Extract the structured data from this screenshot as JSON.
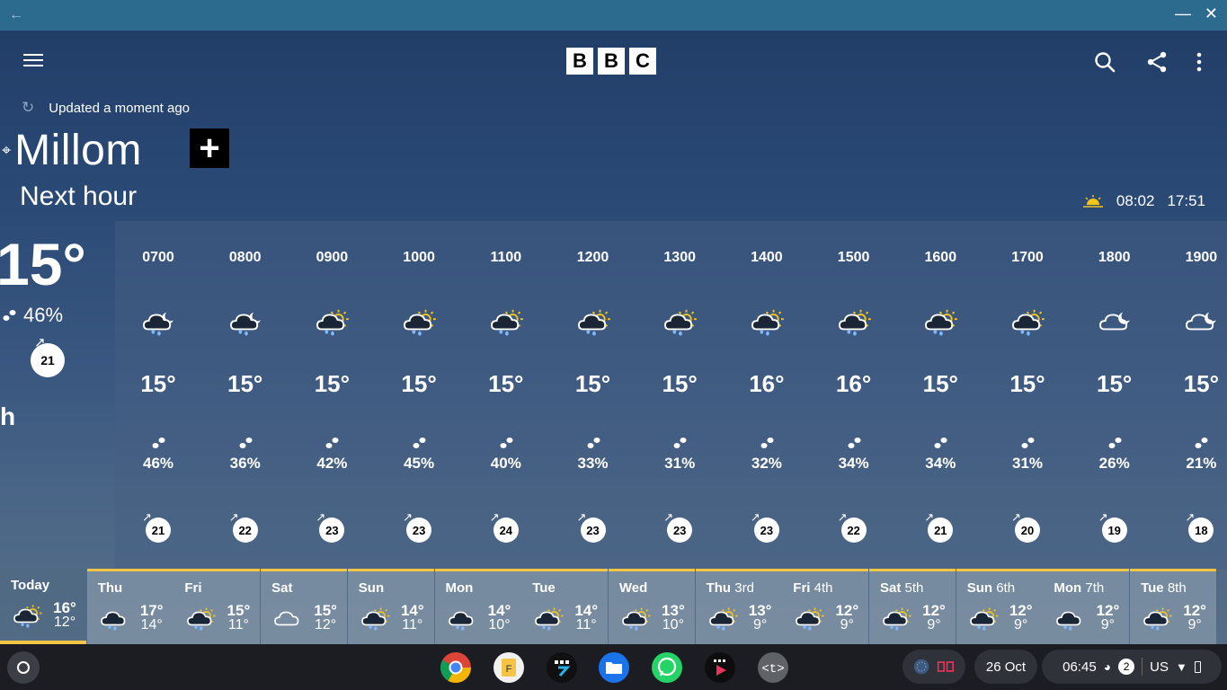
{
  "titlebar": {
    "back_icon": "arrow-left-icon",
    "minimize_icon": "minimize-icon",
    "close_icon": "close-icon"
  },
  "header": {
    "logo_letters": [
      "B",
      "B",
      "C"
    ],
    "menu_icon": "menu-icon",
    "search_icon": "search-icon",
    "share_icon": "share-icon",
    "more_icon": "more-vert-icon"
  },
  "status": {
    "updated_text": "Updated a moment ago"
  },
  "location": {
    "name": "Millom",
    "add_label": "+"
  },
  "section": {
    "title": "Next hour"
  },
  "sun": {
    "sunrise": "08:02",
    "sunset": "17:51"
  },
  "current": {
    "temperature": "15°",
    "precip": "46%",
    "wind": "21",
    "extra": "h"
  },
  "hours": [
    {
      "time": "0700",
      "icon": "night-cloud-rain",
      "temp": "15°",
      "precip": "46%",
      "wind": "21"
    },
    {
      "time": "0800",
      "icon": "night-cloud-rain",
      "temp": "15°",
      "precip": "36%",
      "wind": "22"
    },
    {
      "time": "0900",
      "icon": "sun-cloud-rain",
      "temp": "15°",
      "precip": "42%",
      "wind": "23"
    },
    {
      "time": "1000",
      "icon": "sun-cloud-rain",
      "temp": "15°",
      "precip": "45%",
      "wind": "23"
    },
    {
      "time": "1100",
      "icon": "sun-cloud-rain",
      "temp": "15°",
      "precip": "40%",
      "wind": "24"
    },
    {
      "time": "1200",
      "icon": "sun-cloud-rain",
      "temp": "15°",
      "precip": "33%",
      "wind": "23"
    },
    {
      "time": "1300",
      "icon": "sun-cloud-rain",
      "temp": "15°",
      "precip": "31%",
      "wind": "23"
    },
    {
      "time": "1400",
      "icon": "sun-cloud-rain",
      "temp": "16°",
      "precip": "32%",
      "wind": "23"
    },
    {
      "time": "1500",
      "icon": "sun-cloud-rain",
      "temp": "16°",
      "precip": "34%",
      "wind": "22"
    },
    {
      "time": "1600",
      "icon": "sun-cloud-rain",
      "temp": "15°",
      "precip": "34%",
      "wind": "21"
    },
    {
      "time": "1700",
      "icon": "sun-cloud-rain",
      "temp": "15°",
      "precip": "31%",
      "wind": "20"
    },
    {
      "time": "1800",
      "icon": "night-cloud",
      "temp": "15°",
      "precip": "26%",
      "wind": "19"
    },
    {
      "time": "1900",
      "icon": "night-cloud",
      "temp": "15°",
      "precip": "21%",
      "wind": "18"
    }
  ],
  "days": [
    {
      "name": "Today",
      "date": "",
      "icon": "sun-cloud-rain",
      "high": "16°",
      "low": "12°"
    },
    {
      "name": "Thu",
      "date": "",
      "icon": "cloud-rain",
      "high": "17°",
      "low": "14°"
    },
    {
      "name": "Fri",
      "date": "",
      "icon": "sun-cloud-rain",
      "high": "15°",
      "low": "11°"
    },
    {
      "name": "Sat",
      "date": "",
      "icon": "cloud",
      "high": "15°",
      "low": "12°"
    },
    {
      "name": "Sun",
      "date": "",
      "icon": "sun-cloud-rain",
      "high": "14°",
      "low": "11°"
    },
    {
      "name": "Mon",
      "date": "",
      "icon": "cloud-rain",
      "high": "14°",
      "low": "10°"
    },
    {
      "name": "Tue",
      "date": "",
      "icon": "sun-cloud-rain",
      "high": "14°",
      "low": "11°"
    },
    {
      "name": "Wed",
      "date": "",
      "icon": "sun-cloud-rain",
      "high": "13°",
      "low": "10°"
    },
    {
      "name": "Thu",
      "date": "3rd",
      "icon": "sun-cloud-rain",
      "high": "13°",
      "low": "9°"
    },
    {
      "name": "Fri",
      "date": "4th",
      "icon": "sun-cloud-rain",
      "high": "12°",
      "low": "9°"
    },
    {
      "name": "Sat",
      "date": "5th",
      "icon": "sun-cloud-rain",
      "high": "12°",
      "low": "9°"
    },
    {
      "name": "Sun",
      "date": "6th",
      "icon": "sun-cloud-rain",
      "high": "12°",
      "low": "9°"
    },
    {
      "name": "Mon",
      "date": "7th",
      "icon": "cloud-rain",
      "high": "12°",
      "low": "9°"
    },
    {
      "name": "Tue",
      "date": "8th",
      "icon": "sun-cloud-rain",
      "high": "12°",
      "low": "9°"
    }
  ],
  "taskbar": {
    "apps": [
      "chrome-icon",
      "files-f-icon",
      "grid-app-icon",
      "files-icon",
      "whatsapp-icon",
      "media-player-icon",
      "terminal-icon"
    ],
    "date": "26 Oct",
    "time": "06:45",
    "notification_count": "2",
    "keyboard": "US"
  },
  "colors": {
    "accent": "#f4c542",
    "titlebar": "#2c6a8e",
    "taskbar": "#1b1d22"
  }
}
